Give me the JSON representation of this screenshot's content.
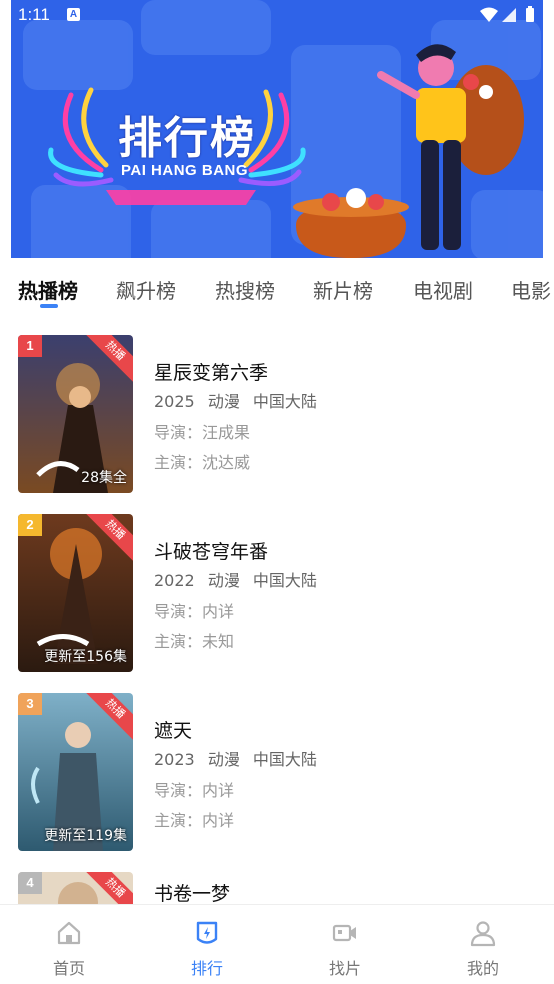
{
  "status_bar": {
    "time": "1:11",
    "indicator": "A"
  },
  "banner": {
    "title": "排行榜",
    "subtitle": "PAI HANG BANG"
  },
  "tabs": [
    {
      "label": "热播榜",
      "active": true
    },
    {
      "label": "飙升榜",
      "active": false
    },
    {
      "label": "热搜榜",
      "active": false
    },
    {
      "label": "新片榜",
      "active": false
    },
    {
      "label": "电视剧",
      "active": false
    },
    {
      "label": "电影",
      "active": false
    }
  ],
  "items": [
    {
      "rank": "1",
      "rank_color": "#e8474a",
      "hot": "热播",
      "episode": "28集全",
      "title": "星辰变第六季",
      "year": "2025",
      "genre": "动漫",
      "region": "中国大陆",
      "director": "导演：汪成果",
      "actor": "主演：沈达威"
    },
    {
      "rank": "2",
      "rank_color": "#f5b82e",
      "hot": "热播",
      "episode": "更新至156集",
      "title": "斗破苍穹年番",
      "year": "2022",
      "genre": "动漫",
      "region": "中国大陆",
      "director": "导演：内详",
      "actor": "主演：未知"
    },
    {
      "rank": "3",
      "rank_color": "#f0a35a",
      "hot": "热播",
      "episode": "更新至119集",
      "title": "遮天",
      "year": "2023",
      "genre": "动漫",
      "region": "中国大陆",
      "director": "导演：内详",
      "actor": "主演：内详"
    },
    {
      "rank": "4",
      "rank_color": "#b8b8b8",
      "hot": "热播",
      "episode": "",
      "title": "书卷一梦",
      "year": "",
      "genre": "",
      "region": "",
      "director": "",
      "actor": ""
    }
  ],
  "bottom_nav": [
    {
      "label": "首页",
      "icon": "home-icon",
      "active": false
    },
    {
      "label": "排行",
      "icon": "ranking-icon",
      "active": true
    },
    {
      "label": "找片",
      "icon": "video-camera-icon",
      "active": false
    },
    {
      "label": "我的",
      "icon": "user-icon",
      "active": false
    }
  ],
  "colors": {
    "accent": "#3b82f6",
    "banner_bg": "#2f63e8",
    "hot": "#e8474a"
  }
}
